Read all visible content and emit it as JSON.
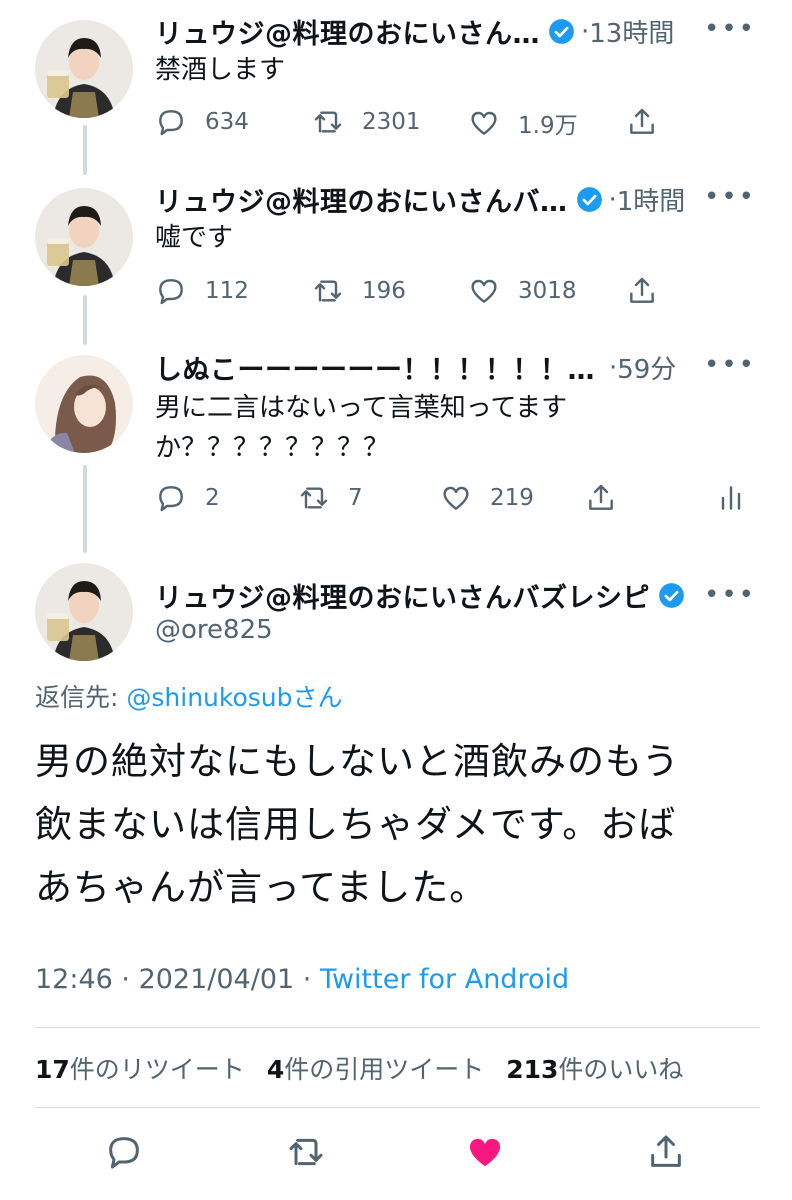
{
  "thread": [
    {
      "author_name": "リュウジ@料理のおにいさん…",
      "separator": "·",
      "time": "13時間",
      "more": "•••",
      "text": "禁酒します",
      "replies": "634",
      "retweets": "2301",
      "likes": "1.9万"
    },
    {
      "author_name": "リュウジ@料理のおにいさんバ…",
      "separator": "·",
      "time": "1時間",
      "more": "•••",
      "text": "嘘です",
      "replies": "112",
      "retweets": "196",
      "likes": "3018"
    },
    {
      "author_name": "しぬこーーーーーー！！！！！！…",
      "separator": "·",
      "time": "59分",
      "more": "•••",
      "text_line1": "男に二言はないって言葉知ってます",
      "text_line2": "か？？？？？？？？",
      "replies": "2",
      "retweets": "7",
      "likes": "219"
    }
  ],
  "main_tweet": {
    "author_name": "リュウジ@料理のおにいさんバズレシピ",
    "handle": "@ore825",
    "more": "•••",
    "reply_to_label": "返信先: ",
    "reply_to_mention": "@shinukosub",
    "reply_to_suffix": "さん",
    "text_line1": "男の絶対なにもしないと酒飲みのもう",
    "text_line2": "飲まないは信用しちゃダメです。おば",
    "text_line3": "あちゃんが言ってました。",
    "time": "12:46",
    "date": "2021/04/01",
    "meta_separator": " · ",
    "client": "Twitter for Android",
    "retweet_count": "17",
    "retweet_label": "件のリツイート",
    "quote_count": "4",
    "quote_label": "件の引用ツイート",
    "like_count": "213",
    "like_label": "件のいいね"
  },
  "colors": {
    "accent": "#1d9bf0",
    "like_active": "#f91880",
    "muted": "#536471"
  },
  "icons": [
    "reply-icon",
    "retweet-icon",
    "like-icon",
    "share-icon",
    "analytics-icon",
    "verified-badge-icon"
  ]
}
